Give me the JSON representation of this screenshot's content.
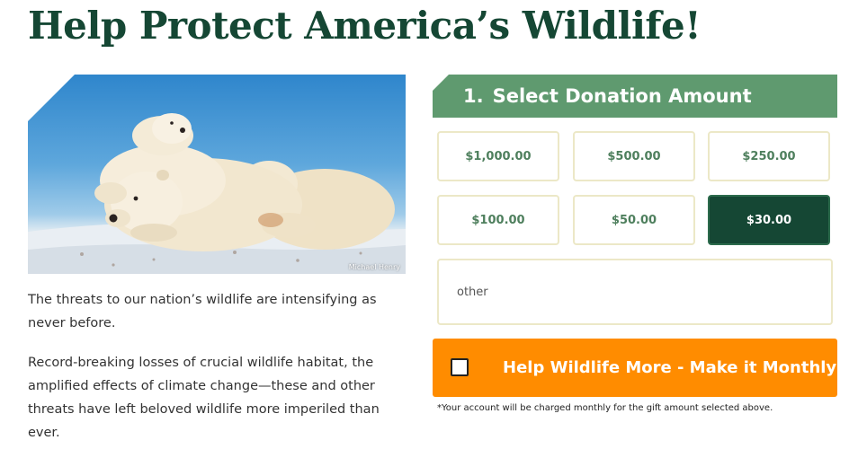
{
  "page": {
    "title": "Help Protect America’s Wildlife!"
  },
  "hero": {
    "photo_credit": "Michael Henry",
    "subject": "polar-bears-photo"
  },
  "copy": {
    "paragraph_1": "The threats to our nation’s wildlife are intensifying as never before.",
    "paragraph_2": "Record-breaking losses of crucial wildlife habitat, the amplified effects of climate change—these and other threats have left beloved wildlife more imperiled than ever."
  },
  "donation": {
    "step_number": "1.",
    "step_title": "Select Donation Amount",
    "amounts": [
      {
        "label": "$1,000.00",
        "selected": false
      },
      {
        "label": "$500.00",
        "selected": false
      },
      {
        "label": "$250.00",
        "selected": false
      },
      {
        "label": "$100.00",
        "selected": false
      },
      {
        "label": "$50.00",
        "selected": false
      },
      {
        "label": "$30.00",
        "selected": true
      }
    ],
    "other_placeholder": "other",
    "other_value": "",
    "monthly_label": "Help Wildlife More - Make it Monthly!",
    "monthly_checked": false,
    "footnote": "*Your account will be charged monthly for the gift amount selected above."
  },
  "colors": {
    "title_green": "#154734",
    "header_green": "#5f9a6f",
    "selected_green": "#154734",
    "amount_text_green": "#4e7f5d",
    "monthly_orange": "#ff8c00",
    "border_cream": "#ece8c7"
  }
}
